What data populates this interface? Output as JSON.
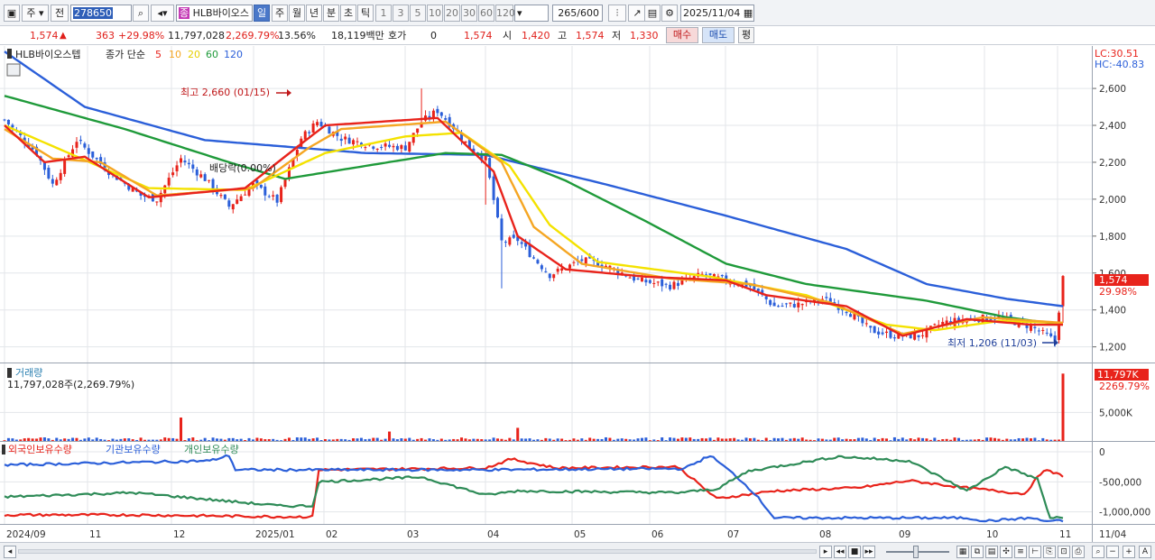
{
  "toolbar": {
    "market": "주",
    "view_mode": "전",
    "stock_code": "278650",
    "stock_name_badge": "종",
    "stock_name": "HLB바이오스",
    "periods": [
      "일",
      "주",
      "월",
      "년",
      "분",
      "초",
      "틱"
    ],
    "active_period": "일",
    "intervals": [
      "1",
      "3",
      "5",
      "10",
      "20",
      "30",
      "60",
      "120"
    ],
    "count_value": "265",
    "count_total": "/600",
    "date": "2025/11/04"
  },
  "quote": {
    "price": "1,574",
    "change": "363",
    "change_pct": "+29.98%",
    "volume": "11,797,028",
    "volume_pct": "2,269.79%",
    "turnover": "13.56%",
    "amount": "18,119백만",
    "hoga_label": "호가",
    "hoga_value": "0",
    "hoga_price": "1,574",
    "open_label": "시",
    "open": "1,420",
    "high_label": "고",
    "high": "1,574",
    "low_label": "저",
    "low": "1,330",
    "buy_label": "매수",
    "sell_label": "매도",
    "eval_label": "평"
  },
  "price_panel": {
    "name_tag": "HLB바이오스텝",
    "ma_title": "종가 단순",
    "ma_periods": [
      "5",
      "10",
      "20",
      "60",
      "120"
    ],
    "ma_colors": [
      "#e8231b",
      "#f5a623",
      "#f4e200",
      "#1f9a3a",
      "#2b5fd9"
    ],
    "lc": "LC:30.51",
    "hc": "HC:-40.83",
    "high_annotation": "최고 2,660 (01/15)",
    "low_annotation": "최저 1,206 (11/03)",
    "dividend_annotation": "배당락(0.00%)",
    "last_price_tag": "1,574",
    "last_pct_tag": "29.98%"
  },
  "volume_panel": {
    "title": "거래량",
    "summary": "11,797,028주(2,269.79%)",
    "last_tag": "11,797K",
    "last_pct": "2269.79%"
  },
  "holdings_panel": {
    "legends": [
      "외국인보유수량",
      "기관보유수량",
      "개인보유수량"
    ],
    "colors": [
      "#e8231b",
      "#2b5fd9",
      "#2e8b57"
    ]
  },
  "x_axis_labels": [
    "2024/09",
    "11",
    "12",
    "2025/01",
    "02",
    "03",
    "04",
    "05",
    "06",
    "07",
    "08",
    "09",
    "10",
    "11",
    "11/04"
  ],
  "chart_data": [
    {
      "type": "line",
      "title": "HLB바이오스텝",
      "ylim": [
        1120,
        2830
      ],
      "y_ticks": [
        "2,600",
        "2,400",
        "2,200",
        "2,000",
        "1,800",
        "1,600",
        "1,400",
        "1,200"
      ],
      "close_keypoints": [
        [
          0,
          2430
        ],
        [
          8,
          2250
        ],
        [
          12,
          2080
        ],
        [
          18,
          2320
        ],
        [
          26,
          2150
        ],
        [
          34,
          2020
        ],
        [
          38,
          2000
        ],
        [
          44,
          2220
        ],
        [
          50,
          2110
        ],
        [
          56,
          1960
        ],
        [
          62,
          2080
        ],
        [
          68,
          1990
        ],
        [
          74,
          2330
        ],
        [
          78,
          2420
        ],
        [
          84,
          2330
        ],
        [
          92,
          2290
        ],
        [
          100,
          2280
        ],
        [
          104,
          2420
        ],
        [
          108,
          2480
        ],
        [
          112,
          2390
        ],
        [
          116,
          2280
        ],
        [
          120,
          2220
        ],
        [
          124,
          1770
        ],
        [
          128,
          1780
        ],
        [
          132,
          1680
        ],
        [
          136,
          1590
        ],
        [
          144,
          1670
        ],
        [
          150,
          1640
        ],
        [
          158,
          1560
        ],
        [
          166,
          1530
        ],
        [
          174,
          1590
        ],
        [
          180,
          1560
        ],
        [
          186,
          1530
        ],
        [
          192,
          1420
        ],
        [
          198,
          1430
        ],
        [
          204,
          1460
        ],
        [
          210,
          1400
        ],
        [
          216,
          1290
        ],
        [
          222,
          1260
        ],
        [
          228,
          1260
        ],
        [
          234,
          1330
        ],
        [
          240,
          1350
        ],
        [
          248,
          1360
        ],
        [
          256,
          1310
        ],
        [
          260,
          1260
        ],
        [
          262,
          1230
        ],
        [
          264,
          1574
        ]
      ],
      "ma_keypoints": {
        "ma5": [
          [
            0,
            2400
          ],
          [
            10,
            2200
          ],
          [
            20,
            2230
          ],
          [
            36,
            2010
          ],
          [
            60,
            2060
          ],
          [
            74,
            2300
          ],
          [
            80,
            2400
          ],
          [
            108,
            2440
          ],
          [
            122,
            2150
          ],
          [
            128,
            1800
          ],
          [
            140,
            1620
          ],
          [
            160,
            1580
          ],
          [
            180,
            1560
          ],
          [
            190,
            1480
          ],
          [
            210,
            1420
          ],
          [
            224,
            1260
          ],
          [
            240,
            1350
          ],
          [
            256,
            1320
          ],
          [
            264,
            1320
          ]
        ],
        "ma10": [
          [
            0,
            2380
          ],
          [
            12,
            2220
          ],
          [
            24,
            2200
          ],
          [
            38,
            2020
          ],
          [
            62,
            2060
          ],
          [
            76,
            2280
          ],
          [
            84,
            2380
          ],
          [
            110,
            2420
          ],
          [
            124,
            2200
          ],
          [
            132,
            1850
          ],
          [
            144,
            1650
          ],
          [
            166,
            1570
          ],
          [
            186,
            1540
          ],
          [
            206,
            1440
          ],
          [
            224,
            1270
          ],
          [
            244,
            1360
          ],
          [
            264,
            1330
          ]
        ],
        "ma20": [
          [
            0,
            2400
          ],
          [
            16,
            2250
          ],
          [
            36,
            2060
          ],
          [
            60,
            2050
          ],
          [
            80,
            2250
          ],
          [
            100,
            2340
          ],
          [
            114,
            2360
          ],
          [
            126,
            2180
          ],
          [
            136,
            1860
          ],
          [
            148,
            1660
          ],
          [
            176,
            1580
          ],
          [
            200,
            1480
          ],
          [
            220,
            1320
          ],
          [
            232,
            1290
          ],
          [
            248,
            1340
          ],
          [
            264,
            1330
          ]
        ],
        "ma60": [
          [
            0,
            2560
          ],
          [
            30,
            2380
          ],
          [
            56,
            2200
          ],
          [
            70,
            2110
          ],
          [
            90,
            2180
          ],
          [
            110,
            2250
          ],
          [
            124,
            2240
          ],
          [
            140,
            2100
          ],
          [
            160,
            1880
          ],
          [
            180,
            1650
          ],
          [
            200,
            1540
          ],
          [
            230,
            1450
          ],
          [
            250,
            1360
          ],
          [
            264,
            1320
          ]
        ],
        "ma120": [
          [
            0,
            2800
          ],
          [
            20,
            2500
          ],
          [
            50,
            2320
          ],
          [
            90,
            2250
          ],
          [
            120,
            2240
          ],
          [
            150,
            2080
          ],
          [
            180,
            1910
          ],
          [
            210,
            1730
          ],
          [
            230,
            1540
          ],
          [
            250,
            1460
          ],
          [
            264,
            1420
          ]
        ]
      }
    },
    {
      "type": "bar",
      "title": "거래량",
      "y_ticks": [
        "5,000K"
      ],
      "ylim": [
        0,
        12000
      ],
      "spikes": [
        [
          44,
          4100
        ],
        [
          96,
          1650
        ],
        [
          128,
          2300
        ],
        [
          264,
          11797
        ]
      ]
    },
    {
      "type": "line",
      "title": "외국인보유수량 / 기관보유수량 / 개인보유수량",
      "ylim": [
        -1200000,
        150000
      ],
      "y_ticks": [
        "0",
        "-500,000",
        "-1,000,000"
      ],
      "series": [
        {
          "name": "외국인보유수량",
          "keypoints": [
            [
              0,
              -1050000
            ],
            [
              40,
              -1050000
            ],
            [
              86,
              -1080000
            ],
            [
              96,
              -1080000
            ],
            [
              98,
              -300000
            ],
            [
              150,
              -270000
            ],
            [
              158,
              -120000
            ],
            [
              172,
              -270000
            ],
            [
              210,
              -250000
            ],
            [
              222,
              -780000
            ],
            [
              240,
              -650000
            ],
            [
              266,
              -600000
            ],
            [
              282,
              -480000
            ],
            [
              300,
              -600000
            ],
            [
              318,
              -700000
            ],
            [
              324,
              -300000
            ],
            [
              330,
              -400000
            ]
          ]
        },
        {
          "name": "기관보유수량",
          "keypoints": [
            [
              0,
              -220000
            ],
            [
              64,
              -150000
            ],
            [
              70,
              -60000
            ],
            [
              72,
              -300000
            ],
            [
              150,
              -300000
            ],
            [
              212,
              -280000
            ],
            [
              220,
              -60000
            ],
            [
              228,
              -400000
            ],
            [
              234,
              -700000
            ],
            [
              240,
              -1100000
            ],
            [
              300,
              -1100000
            ],
            [
              306,
              -1150000
            ],
            [
              320,
              -1100000
            ],
            [
              324,
              -1150000
            ],
            [
              330,
              -1150000
            ]
          ]
        },
        {
          "name": "개인보유수량",
          "keypoints": [
            [
              0,
              -750000
            ],
            [
              40,
              -680000
            ],
            [
              86,
              -900000
            ],
            [
              96,
              -900000
            ],
            [
              98,
              -500000
            ],
            [
              130,
              -420000
            ],
            [
              150,
              -720000
            ],
            [
              160,
              -650000
            ],
            [
              210,
              -680000
            ],
            [
              222,
              -620000
            ],
            [
              232,
              -320000
            ],
            [
              260,
              -80000
            ],
            [
              282,
              -150000
            ],
            [
              300,
              -650000
            ],
            [
              312,
              -250000
            ],
            [
              322,
              -450000
            ],
            [
              326,
              -1100000
            ]
          ]
        }
      ]
    }
  ]
}
